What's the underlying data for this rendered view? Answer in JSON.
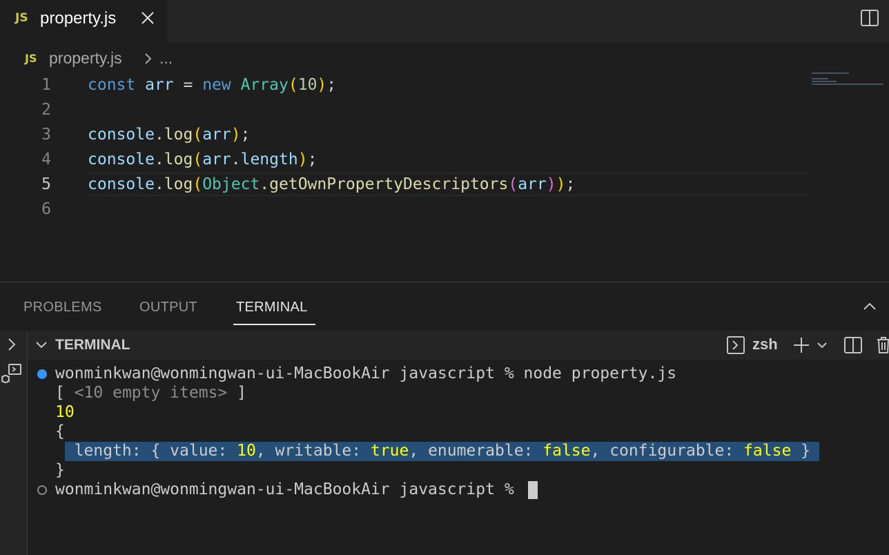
{
  "tab": {
    "icon": "JS",
    "title": "property.js"
  },
  "breadcrumb": {
    "icon": "JS",
    "file": "property.js",
    "more": "..."
  },
  "editor": {
    "line_numbers": [
      "1",
      "2",
      "3",
      "4",
      "5",
      "6"
    ],
    "lines": {
      "l1": {
        "const": "const",
        "arr": "arr",
        "eq": " = ",
        "new": "new",
        "Array": "Array",
        "po": "(",
        "ten": "10",
        "pc": ")",
        "semi": ";"
      },
      "l3": {
        "console": "console",
        "dot": ".",
        "log": "log",
        "po": "(",
        "arr": "arr",
        "pc": ")",
        "semi": ";"
      },
      "l4": {
        "console": "console",
        "dot": ".",
        "log": "log",
        "po": "(",
        "arr": "arr",
        "dot2": ".",
        "length": "length",
        "pc": ")",
        "semi": ";"
      },
      "l5": {
        "console": "console",
        "dot": ".",
        "log": "log",
        "po": "(",
        "Object": "Object",
        "dot2": ".",
        "fn": "getOwnPropertyDescriptors",
        "po2": "(",
        "arr": "arr",
        "pc2": ")",
        "pc": ")",
        "semi": ";"
      }
    }
  },
  "panel": {
    "tabs": [
      "PROBLEMS",
      "OUTPUT",
      "TERMINAL"
    ],
    "active_tab": "TERMINAL",
    "section_title": "TERMINAL",
    "shell": "zsh"
  },
  "terminal": {
    "prompt": "wonminkwan@wonmingwan-ui-MacBookAir javascript % ",
    "command": "node property.js",
    "out1_open": "[ ",
    "out1_mid": "<10 empty items>",
    "out1_close": " ]",
    "out2": "10",
    "out3": "{",
    "out4": {
      "a": "  length: { value: ",
      "b": "10",
      "c": ", writable: ",
      "d": "true",
      "e": ", enumerable: ",
      "f": "false",
      "g": ", configurable: ",
      "h": "false",
      "i": " }"
    },
    "out5": "}",
    "prompt2": "wonminkwan@wonmingwan-ui-MacBookAir javascript % "
  },
  "colors": {
    "accent_yellow": "#ffff00",
    "selection": "#264f78",
    "js_badge": "#cbcb41"
  }
}
